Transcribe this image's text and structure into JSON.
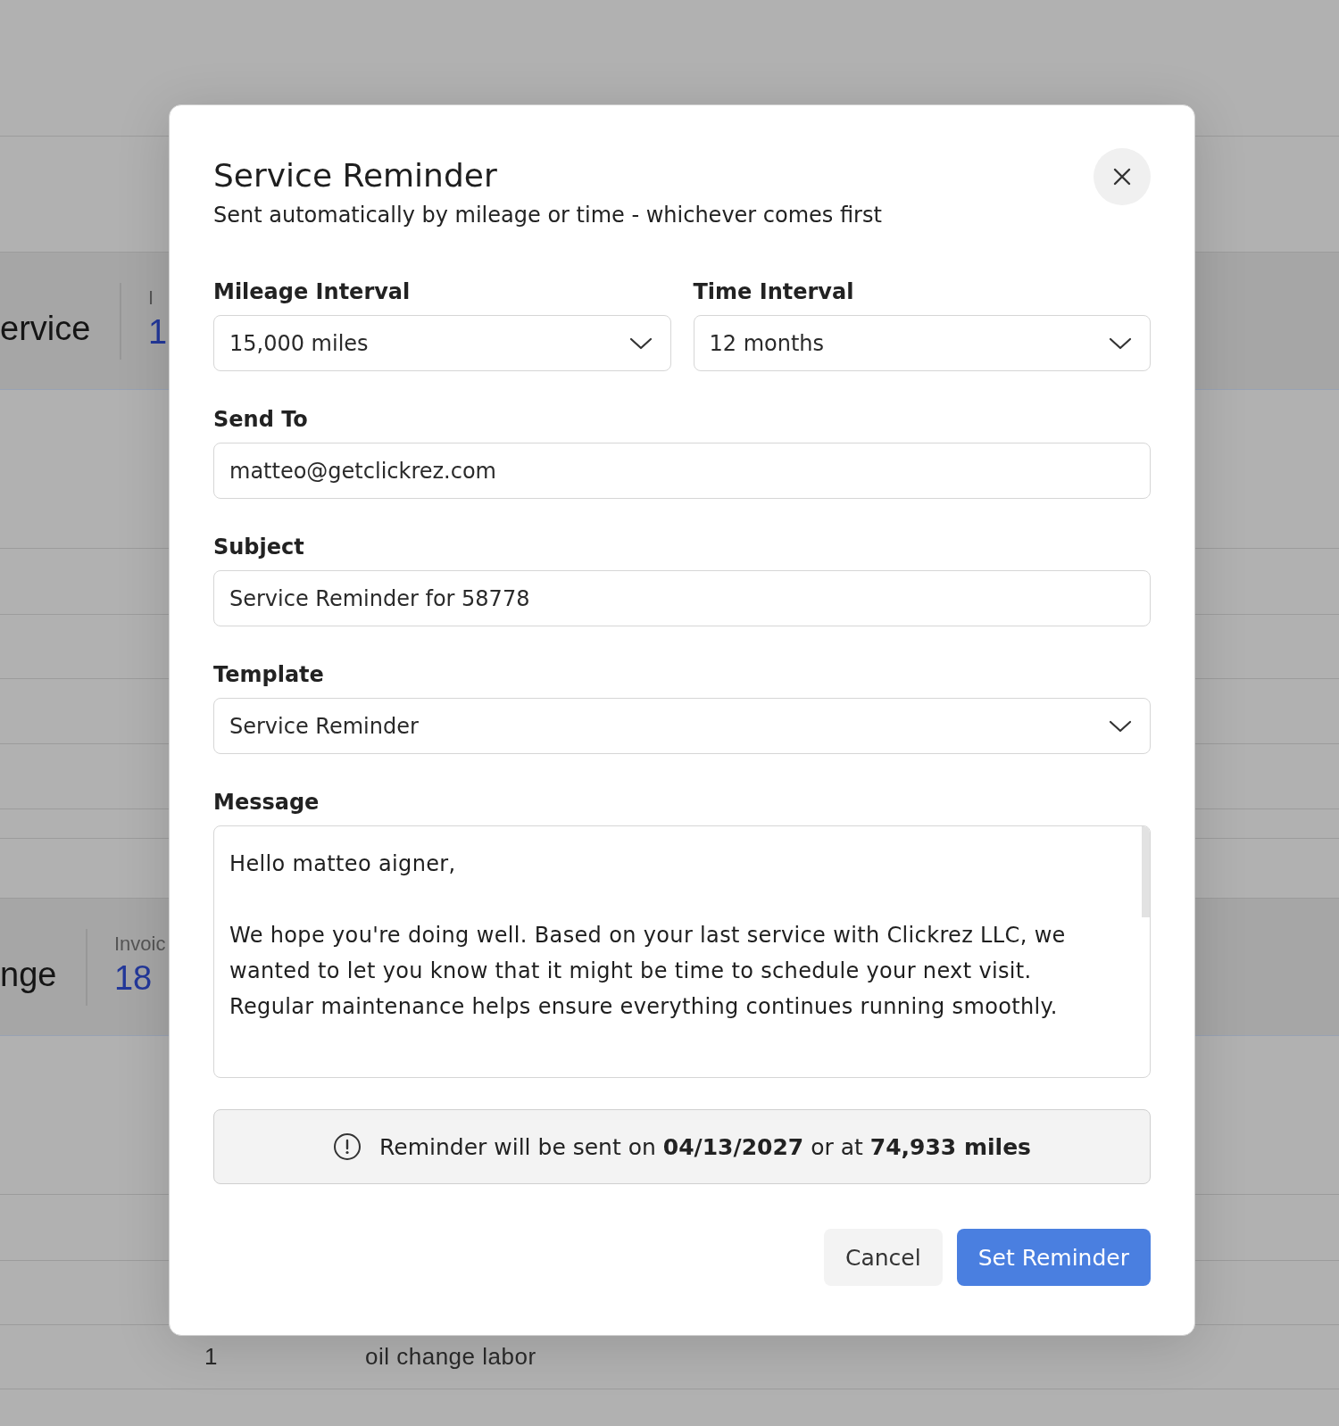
{
  "background": {
    "sections": [
      {
        "title": "ervice",
        "stat_label": "I",
        "stat_value": "1"
      },
      {
        "title": "nge",
        "stat_label": "Invoic",
        "stat_value": "18"
      }
    ],
    "rows": [
      {
        "qty": "1",
        "description": "oil change labor"
      }
    ]
  },
  "dialog": {
    "title": "Service Reminder",
    "subtitle": "Sent automatically by mileage or time - whichever comes first",
    "field_rows": [
      [
        {
          "kind": "select",
          "label": "Mileage Interval",
          "value": "15,000 miles"
        },
        {
          "kind": "select",
          "label": "Time Interval",
          "value": "12 months"
        }
      ],
      [
        {
          "kind": "input",
          "label": "Send To",
          "value": "matteo@getclickrez.com"
        }
      ],
      [
        {
          "kind": "input",
          "label": "Subject",
          "value": "Service Reminder for 58778"
        }
      ],
      [
        {
          "kind": "select",
          "label": "Template",
          "value": "Service Reminder"
        }
      ],
      [
        {
          "kind": "textarea",
          "label": "Message",
          "value": "Hello matteo aigner,\n\nWe hope you're doing well. Based on your last service with Clickrez LLC, we wanted to let you know that it might be time to schedule your next visit. Regular maintenance helps ensure everything continues running smoothly."
        }
      ]
    ],
    "notice": "Reminder will be sent on **04/13/2027** or at **74,933 miles**",
    "buttons": [
      {
        "kind": "secondary",
        "label": "Cancel"
      },
      {
        "kind": "primary",
        "label": "Set Reminder"
      }
    ]
  }
}
